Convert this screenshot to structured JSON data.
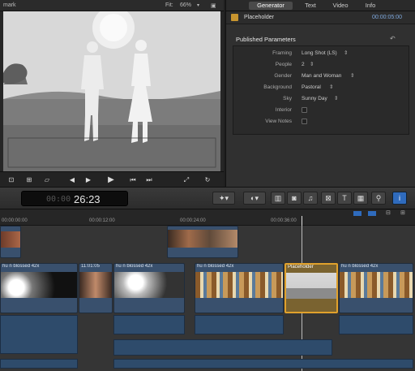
{
  "viewer": {
    "title": "mark",
    "fit_label": "Fit:",
    "zoom": "66%",
    "controls": [
      "crop",
      "transform",
      "distort",
      "prev",
      "play",
      "next",
      "fullscreen",
      "loop"
    ]
  },
  "inspector": {
    "tabs": [
      "Generator",
      "Text",
      "Video",
      "Info"
    ],
    "active_tab": "Generator",
    "clip_name": "Placeholder",
    "clip_duration": "00:00:05:00",
    "section_title": "Published Parameters",
    "params": [
      {
        "label": "Framing",
        "value": "Long Shot (LS)"
      },
      {
        "label": "People",
        "value": "2"
      },
      {
        "label": "Gender",
        "value": "Man and Woman"
      },
      {
        "label": "Background",
        "value": "Pastoral"
      },
      {
        "label": "Sky",
        "value": "Sunny Day"
      },
      {
        "label": "Interior",
        "value": ""
      },
      {
        "label": "View Notes",
        "value": ""
      }
    ]
  },
  "toolbar": {
    "timecode": "26:23"
  },
  "ruler": {
    "ticks": [
      "00:00:00:00",
      "00:00:12:00",
      "00:00:24:00",
      "00:00:36:00"
    ]
  },
  "timeline": {
    "connected_clips": [
      "",
      "",
      ""
    ],
    "clips": [
      {
        "name": "hu n blossed 42x"
      },
      {
        "name": "11:01:05"
      },
      {
        "name": "hu n blossed 42x"
      },
      {
        "name": "hu n blossed 42x"
      },
      {
        "name": "Placeholder"
      },
      {
        "name": "hu n blossed 42x"
      }
    ]
  },
  "colors": {
    "accent": "#3f7cc7",
    "selected_clip": "#e0a12c",
    "clip_blue": "#39506d",
    "timecode_green": "#2f9b42"
  }
}
